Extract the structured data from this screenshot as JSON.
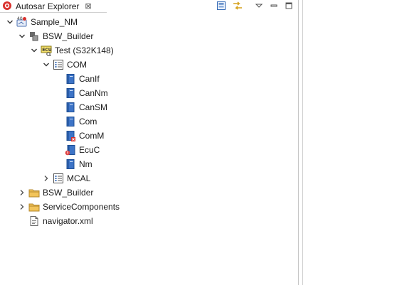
{
  "tab": {
    "title": "Autosar Explorer",
    "close_glyph": "⊠"
  },
  "toolbar": {
    "collapse_all": "collapse-all-icon",
    "link_editor": "link-with-editor-icon",
    "view_menu": "view-menu-icon",
    "minimize": "minimize-icon",
    "maximize": "maximize-icon"
  },
  "tree": [
    {
      "label": "Sample_NM",
      "icon": "autosar-project-icon",
      "level": 0,
      "state": "expanded"
    },
    {
      "label": "BSW_Builder",
      "icon": "bsw-builder-icon",
      "level": 1,
      "state": "expanded"
    },
    {
      "label": "Test (S32K148)",
      "icon": "ecu-config-icon",
      "level": 2,
      "state": "expanded"
    },
    {
      "label": "COM",
      "icon": "module-list-icon",
      "level": 3,
      "state": "expanded"
    },
    {
      "label": "CanIf",
      "icon": "module-book-icon",
      "level": 4,
      "state": "leaf"
    },
    {
      "label": "CanNm",
      "icon": "module-book-icon",
      "level": 4,
      "state": "leaf"
    },
    {
      "label": "CanSM",
      "icon": "module-book-icon",
      "level": 4,
      "state": "leaf"
    },
    {
      "label": "Com",
      "icon": "module-book-icon",
      "level": 4,
      "state": "leaf"
    },
    {
      "label": "ComM",
      "icon": "module-book-error-icon",
      "level": 4,
      "state": "leaf"
    },
    {
      "label": "EcuC",
      "icon": "module-book-warning-icon",
      "level": 4,
      "state": "leaf"
    },
    {
      "label": "Nm",
      "icon": "module-book-icon",
      "level": 4,
      "state": "leaf"
    },
    {
      "label": "MCAL",
      "icon": "module-list-icon",
      "level": 3,
      "state": "collapsed"
    },
    {
      "label": "BSW_Builder",
      "icon": "folder-icon",
      "level": 1,
      "state": "collapsed"
    },
    {
      "label": "ServiceComponents",
      "icon": "folder-icon",
      "level": 1,
      "state": "collapsed"
    },
    {
      "label": "navigator.xml",
      "icon": "xml-file-icon",
      "level": 1,
      "state": "leaf"
    }
  ]
}
